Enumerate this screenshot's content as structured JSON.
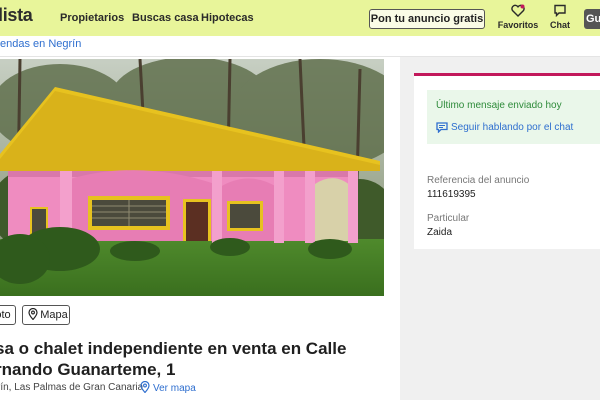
{
  "header": {
    "logo": "lista",
    "nav": [
      "Propietarios",
      "Buscas casa",
      "Hipotecas"
    ],
    "publish_button": "Pon tu anuncio gratis",
    "favorites_label": "Favoritos",
    "chat_label": "Chat",
    "user_chip": "Gu"
  },
  "breadcrumb": "endas en Negrín",
  "photo": {
    "foto_chip": "oto",
    "map_chip": "Mapa"
  },
  "listing": {
    "title": "sa o chalet independiente en venta en Calle rnando Guanarteme, 1",
    "location": "rín, Las Palmas de Gran Canaria",
    "map_link": "Ver mapa"
  },
  "contact": {
    "last_message": "Último mensaje enviado hoy",
    "continue_chat": "Seguir hablando por el chat",
    "ref_label": "Referencia del anuncio",
    "ref_value": "111619395",
    "advertiser_type": "Particular",
    "advertiser_name": "Zaida"
  },
  "colors": {
    "header_bg": "#e8f59a",
    "link": "#2f6fcf",
    "accent": "#c2185b",
    "message_text": "#2e8b3a"
  },
  "icons": [
    "heart-icon",
    "chat-icon",
    "map-pin-icon",
    "chat-bubble-icon"
  ]
}
